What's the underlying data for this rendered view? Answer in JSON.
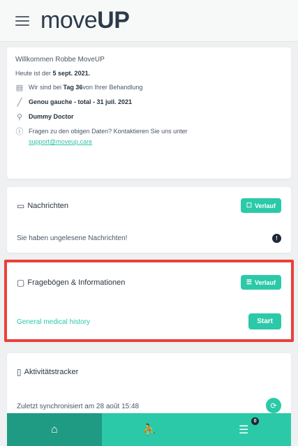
{
  "header": {
    "logo_light": "move",
    "logo_bold": "UP"
  },
  "welcome": {
    "greeting": "Willkommen Robbe MoveUP",
    "today_prefix": "Heute ist der ",
    "today_date": "5 sept. 2021.",
    "day_prefix": "Wir sind bei ",
    "day_value": "Tag 36",
    "day_suffix": " von Ihrer Behandlung",
    "surgery": "Genou gauche - total - 31 juil. 2021",
    "doctor": "Dummy Doctor",
    "questions": "Fragen zu den obigen Daten? Kontaktieren Sie uns unter",
    "contact_link": "support@moveup.care"
  },
  "messages": {
    "title": "Nachrichten",
    "button": "Verlauf",
    "unread_text": "Sie haben ungelesene Nachrichten!",
    "badge": "!"
  },
  "questionnaires": {
    "title": "Fragebögen & Informationen",
    "button": "Verlauf",
    "item": "General medical history",
    "start_button": "Start"
  },
  "activity": {
    "title": "Aktivitätstracker",
    "sync_text": "Zuletzt synchronisiert am 28 août 15:48"
  },
  "nav": {
    "badge": "0"
  },
  "colors": {
    "accent": "#2bc9a8",
    "highlight": "#e8413a",
    "nav_active": "#1f9b84"
  }
}
